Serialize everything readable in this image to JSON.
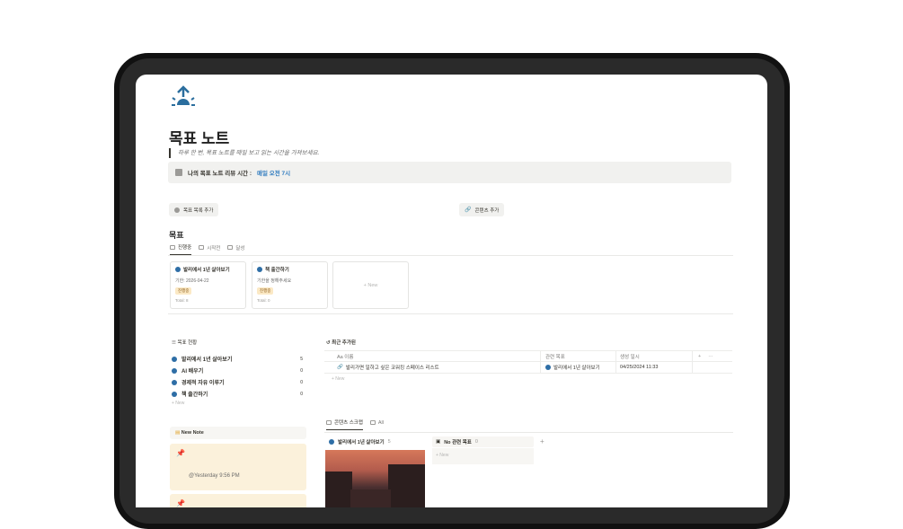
{
  "page": {
    "title": "목표 노트",
    "quote": "하루 한 번, 목표 노트를 매일 보고 읽는 시간을 가져보세요.",
    "callout_label": "나의 목표 노트 리뷰 시간 :",
    "callout_value": "매일 오전 7시"
  },
  "buttons": {
    "add_goal": "목표 목록 추가",
    "add_content": "콘텐츠 추가"
  },
  "goals": {
    "heading": "목표",
    "tabs": [
      "진행중",
      "시작전",
      "달성"
    ],
    "cards": [
      {
        "title": "발리에서 1년 살아보기",
        "line": "기한: 2026-04-22",
        "tag": "진행중",
        "total": "Total: 8"
      },
      {
        "title": "책 출간하기",
        "line": "기한을 정해주세요",
        "tag": "진행중",
        "total": "Total: 0"
      }
    ],
    "new_label": "+ New"
  },
  "status": {
    "heading": "목표 현황",
    "items": [
      {
        "name": "발리에서 1년 살아보기",
        "count": "5"
      },
      {
        "name": "AI 배우기",
        "count": "0"
      },
      {
        "name": "경제적 자유 이루기",
        "count": "0"
      },
      {
        "name": "책 출간하기",
        "count": "0"
      }
    ],
    "new_label": "+ New"
  },
  "recent": {
    "heading": "최근 추가된",
    "columns": [
      "Aa 이름",
      "관련 목표",
      "생성 일시"
    ],
    "rows": [
      {
        "name": "발리가면 일하고 싶은 코워킹 스페이스 리스트",
        "goal": "발리에서 1년 살아보기",
        "date": "04/25/2024 11:33"
      }
    ],
    "new_label": "+ New"
  },
  "notes": {
    "heading": "New Note",
    "timestamp": "@Yesterday 9:56 PM"
  },
  "board": {
    "tabs": [
      "콘텐츠 스크랩",
      "All"
    ],
    "col1": "발리에서 1년 살아보기",
    "col1_count": "5",
    "col2": "No 관련 목표",
    "col2_count": "0",
    "new_label": "+ New"
  },
  "colors": {
    "accent_blue": "#2f7bbf",
    "dot_blue": "#2e6ea6",
    "note_bg": "#fbf1db"
  }
}
